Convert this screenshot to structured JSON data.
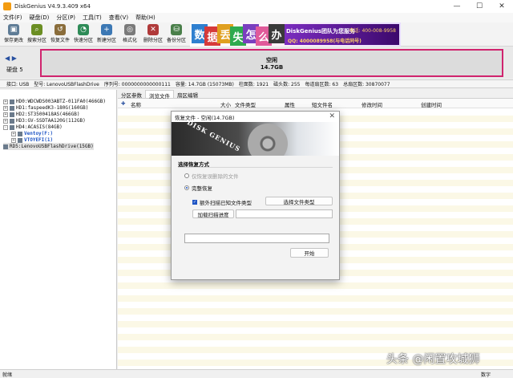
{
  "window": {
    "title": "DiskGenius V4.9.3.409 x64",
    "min": "—",
    "max": "☐",
    "close": "✕"
  },
  "menu": [
    "文件(F)",
    "硬盘(D)",
    "分区(P)",
    "工具(T)",
    "查看(V)",
    "帮助(H)"
  ],
  "toolbar": [
    {
      "label": "保存更改",
      "icon": "save-icon",
      "color": "#5f7c96",
      "glyph": "▣"
    },
    {
      "label": "搜索分区",
      "icon": "search-icon",
      "color": "#6b8e23",
      "glyph": "⌕"
    },
    {
      "label": "恢复文件",
      "icon": "recover-icon",
      "color": "#8a6d3b",
      "glyph": "↺"
    },
    {
      "label": "快速分区",
      "icon": "quick-partition-icon",
      "color": "#2e8b57",
      "glyph": "◔"
    },
    {
      "label": "新建分区",
      "icon": "new-partition-icon",
      "color": "#3c78b4",
      "glyph": "+"
    },
    {
      "label": "格式化",
      "icon": "format-icon",
      "color": "#7a7a7a",
      "glyph": "◎"
    },
    {
      "label": "删除分区",
      "icon": "delete-partition-icon",
      "color": "#b03a3a",
      "glyph": "✕"
    },
    {
      "label": "备份分区",
      "icon": "backup-icon",
      "color": "#4a7f4a",
      "glyph": "⛁"
    }
  ],
  "ad": {
    "tiles": [
      {
        "text": "数",
        "color": "#2f80d0"
      },
      {
        "text": "据",
        "color": "#d63a3a"
      },
      {
        "text": "丢",
        "color": "#e0a020"
      },
      {
        "text": "失",
        "color": "#2eaa4e"
      },
      {
        "text": "怎",
        "color": "#7a3fbf"
      },
      {
        "text": "么",
        "color": "#e05a9a"
      },
      {
        "text": "办",
        "color": "#3a3a3a"
      }
    ],
    "line1": "DiskGenius团队为您服务",
    "phone": "电话: 400-008-9958",
    "qq": "QQ: 4000089958(与电话同号)"
  },
  "disk": {
    "nav_left": "◀",
    "nav_right": "▶",
    "label": "硬盘 5",
    "partition_name": "空闲",
    "partition_size": "14.7GB"
  },
  "info": [
    "接口: USB",
    "型号: LenovoUSBFlashDrive",
    "序列号: 0000000000000111",
    "容量: 14.7GB (15073MB)",
    "柱面数: 1921",
    "磁头数: 255",
    "每道扇区数: 63",
    "总扇区数: 30870077"
  ],
  "tree": [
    {
      "exp": "+",
      "label": "HD0:WDCWDS003ABTZ-011FA0(466GB)",
      "indent": 0,
      "blue": false,
      "sel": false
    },
    {
      "exp": "+",
      "label": "HD1:faspeedK3-180G(160GB)",
      "indent": 0,
      "blue": false,
      "sel": false
    },
    {
      "exp": "+",
      "label": "HD2:ST3500418AS(466GB)",
      "indent": 0,
      "blue": false,
      "sel": false
    },
    {
      "exp": "+",
      "label": "HD3:GV-SSDTAA120G(112GB)",
      "indent": 0,
      "blue": false,
      "sel": false
    },
    {
      "exp": "-",
      "label": "HD4:ACASIS(84GB)",
      "indent": 0,
      "blue": false,
      "sel": false
    },
    {
      "exp": "+",
      "label": "Ventoy(F:)",
      "indent": 10,
      "blue": true,
      "sel": false
    },
    {
      "exp": "+",
      "label": "VTOYEFI(1)",
      "indent": 10,
      "blue": true,
      "sel": false
    },
    {
      "exp": "",
      "label": "RD5:LenovoUSBFlashDrive(15GB)",
      "indent": 0,
      "blue": false,
      "sel": true
    }
  ],
  "tabs": [
    "分区参数",
    "浏览文件",
    "扇区编辑"
  ],
  "columns": [
    "名称",
    "大小",
    "文件类型",
    "属性",
    "短文件名",
    "修改时间",
    "创建时间"
  ],
  "status": {
    "left": "就绪",
    "right": "数字"
  },
  "watermark": "头条 @闲置攻城狮",
  "dialog": {
    "title": "恢复文件 - 空闲(14.7GB)",
    "close": "✕",
    "brand": "DISK GENIUS",
    "section": "选择恢复方式",
    "opt1": "仅恢复误删除的文件",
    "opt2": "完整恢复",
    "check1": "额外扫描已知文件类型",
    "select_type_btn": "选择文件类型",
    "load_progress_btn": "加载扫描进度",
    "progress_value": 0,
    "start_btn": "开始"
  }
}
